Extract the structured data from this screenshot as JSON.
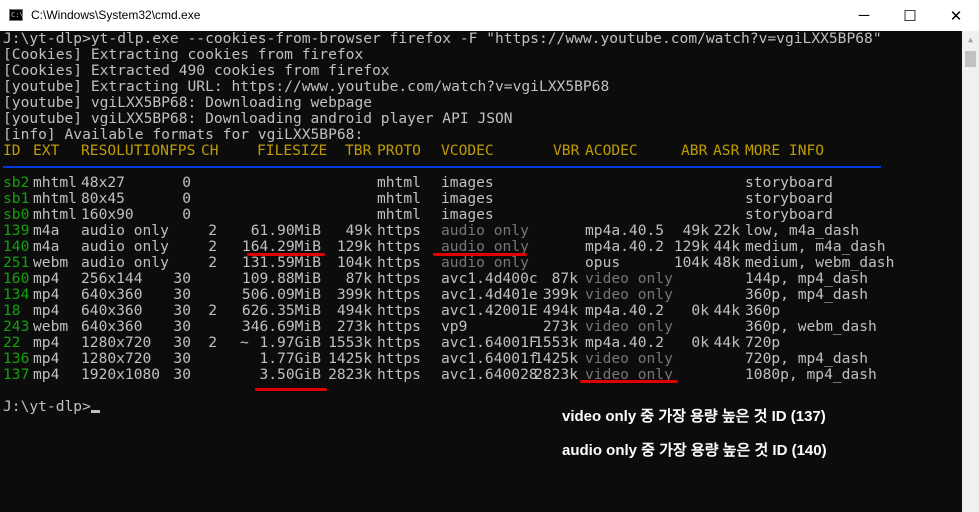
{
  "window": {
    "title": "C:\\Windows\\System32\\cmd.exe",
    "minimize_glyph": "─",
    "maximize_glyph": "☐",
    "close_glyph": "✕",
    "icon_text": "C:\\"
  },
  "console": {
    "log_lines": [
      "J:\\yt-dlp>yt-dlp.exe --cookies-from-browser firefox -F \"https://www.youtube.com/watch?v=vgiLXX5BP68\"",
      "[Cookies] Extracting cookies from firefox",
      "[Cookies] Extracted 490 cookies from firefox",
      "[youtube] Extracting URL: https://www.youtube.com/watch?v=vgiLXX5BP68",
      "[youtube] vgiLXX5BP68: Downloading webpage",
      "[youtube] vgiLXX5BP68: Downloading android player API JSON",
      "[info] Available formats for vgiLXX5BP68:"
    ],
    "headers": [
      "ID",
      "EXT",
      "RESOLUTION",
      "FPS",
      "CH",
      "FILESIZE",
      "TBR",
      "PROTO",
      "VCODEC",
      "VBR",
      "ACODEC",
      "ABR",
      "ASR",
      "MORE INFO"
    ],
    "rows": [
      {
        "id": "sb2",
        "ext": "mhtml",
        "res": "48x27",
        "fps": "0",
        "ch": "",
        "tilde": "",
        "size": "",
        "tbr": "",
        "proto": "mhtml",
        "vcodec": "images",
        "vbr": "",
        "acodec": "",
        "abr": "",
        "asr": "",
        "info": "storyboard"
      },
      {
        "id": "sb1",
        "ext": "mhtml",
        "res": "80x45",
        "fps": "0",
        "ch": "",
        "tilde": "",
        "size": "",
        "tbr": "",
        "proto": "mhtml",
        "vcodec": "images",
        "vbr": "",
        "acodec": "",
        "abr": "",
        "asr": "",
        "info": "storyboard"
      },
      {
        "id": "sb0",
        "ext": "mhtml",
        "res": "160x90",
        "fps": "0",
        "ch": "",
        "tilde": "",
        "size": "",
        "tbr": "",
        "proto": "mhtml",
        "vcodec": "images",
        "vbr": "",
        "acodec": "",
        "abr": "",
        "asr": "",
        "info": "storyboard"
      },
      {
        "id": "139",
        "ext": "m4a",
        "res": "audio only",
        "fps": "",
        "ch": "2",
        "tilde": "",
        "size": "61.90MiB",
        "tbr": "49k",
        "proto": "https",
        "vcodec": "audio only",
        "vbr": "",
        "acodec": "mp4a.40.5",
        "abr": "49k",
        "asr": "22k",
        "info": "low, m4a_dash"
      },
      {
        "id": "140",
        "ext": "m4a",
        "res": "audio only",
        "fps": "",
        "ch": "2",
        "tilde": "",
        "size": "164.29MiB",
        "tbr": "129k",
        "proto": "https",
        "vcodec": "audio only",
        "vbr": "",
        "acodec": "mp4a.40.2",
        "abr": "129k",
        "asr": "44k",
        "info": "medium, m4a_dash"
      },
      {
        "id": "251",
        "ext": "webm",
        "res": "audio only",
        "fps": "",
        "ch": "2",
        "tilde": "",
        "size": "131.59MiB",
        "tbr": "104k",
        "proto": "https",
        "vcodec": "audio only",
        "vbr": "",
        "acodec": "opus",
        "abr": "104k",
        "asr": "48k",
        "info": "medium, webm_dash"
      },
      {
        "id": "160",
        "ext": "mp4",
        "res": "256x144",
        "fps": "30",
        "ch": "",
        "tilde": "",
        "size": "109.88MiB",
        "tbr": "87k",
        "proto": "https",
        "vcodec": "avc1.4d400c",
        "vbr": "87k",
        "acodec": "video only",
        "abr": "",
        "asr": "",
        "info": "144p, mp4_dash"
      },
      {
        "id": "134",
        "ext": "mp4",
        "res": "640x360",
        "fps": "30",
        "ch": "",
        "tilde": "",
        "size": "506.09MiB",
        "tbr": "399k",
        "proto": "https",
        "vcodec": "avc1.4d401e",
        "vbr": "399k",
        "acodec": "video only",
        "abr": "",
        "asr": "",
        "info": "360p, mp4_dash"
      },
      {
        "id": "18",
        "ext": "mp4",
        "res": "640x360",
        "fps": "30",
        "ch": "2",
        "tilde": "",
        "size": "626.35MiB",
        "tbr": "494k",
        "proto": "https",
        "vcodec": "avc1.42001E",
        "vbr": "494k",
        "acodec": "mp4a.40.2",
        "abr": "0k",
        "asr": "44k",
        "info": "360p"
      },
      {
        "id": "243",
        "ext": "webm",
        "res": "640x360",
        "fps": "30",
        "ch": "",
        "tilde": "",
        "size": "346.69MiB",
        "tbr": "273k",
        "proto": "https",
        "vcodec": "vp9",
        "vbr": "273k",
        "acodec": "video only",
        "abr": "",
        "asr": "",
        "info": "360p, webm_dash"
      },
      {
        "id": "22",
        "ext": "mp4",
        "res": "1280x720",
        "fps": "30",
        "ch": "2",
        "tilde": "~",
        "size": "1.97GiB",
        "tbr": "1553k",
        "proto": "https",
        "vcodec": "avc1.64001F",
        "vbr": "1553k",
        "acodec": "mp4a.40.2",
        "abr": "0k",
        "asr": "44k",
        "info": "720p"
      },
      {
        "id": "136",
        "ext": "mp4",
        "res": "1280x720",
        "fps": "30",
        "ch": "",
        "tilde": "",
        "size": "1.77GiB",
        "tbr": "1425k",
        "proto": "https",
        "vcodec": "avc1.64001f",
        "vbr": "1425k",
        "acodec": "video only",
        "abr": "",
        "asr": "",
        "info": "720p, mp4_dash"
      },
      {
        "id": "137",
        "ext": "mp4",
        "res": "1920x1080",
        "fps": "30",
        "ch": "",
        "tilde": "",
        "size": "3.50GiB",
        "tbr": "2823k",
        "proto": "https",
        "vcodec": "avc1.640028",
        "vbr": "2823k",
        "acodec": "video only",
        "abr": "",
        "asr": "",
        "info": "1080p, mp4_dash"
      }
    ],
    "prompt": "J:\\yt-dlp>"
  },
  "annotations": {
    "video": "video only 중 가장 용량 높은 것 ID (137)",
    "audio": "audio only 중 가장 용량 높은 것 ID (140)"
  },
  "colors": {
    "id_green": "#13a10e",
    "header_yellow": "#c19c00",
    "dim_gray": "#767676",
    "separator_blue": "#0037da",
    "highlight_red": "#e00000"
  }
}
